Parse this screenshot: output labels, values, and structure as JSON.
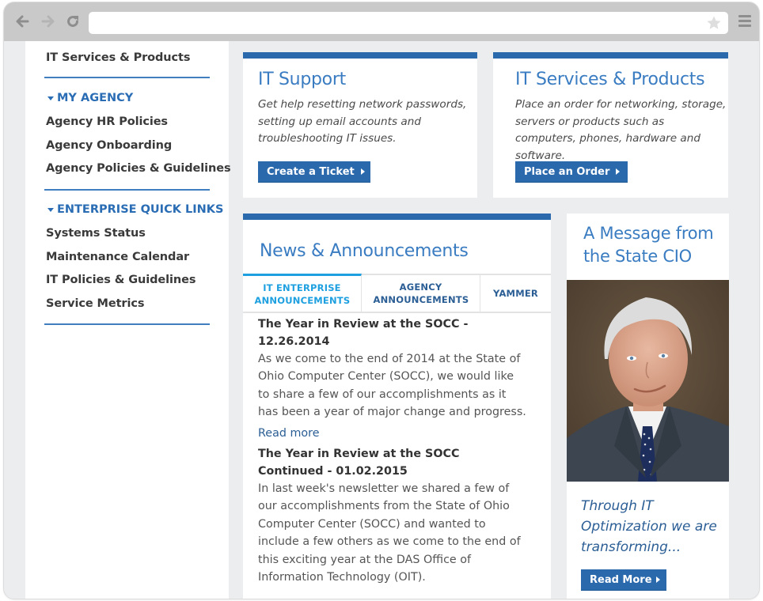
{
  "browser": {
    "icons": [
      "back-arrow-icon",
      "forward-arrow-icon",
      "reload-icon",
      "star-icon",
      "hamburger-menu-icon"
    ],
    "url": ""
  },
  "sidebar": {
    "top_link": "IT Services & Products",
    "sections": [
      {
        "heading": "MY AGENCY",
        "items": [
          "Agency HR Policies",
          "Agency Onboarding",
          "Agency Policies & Guidelines"
        ]
      },
      {
        "heading": "ENTERPRISE QUICK LINKS",
        "items": [
          "Systems Status",
          "Maintenance Calendar",
          "IT Policies & Guidelines",
          "Service Metrics"
        ]
      }
    ]
  },
  "cards": {
    "it_support": {
      "title": "IT Support",
      "description": "Get help resetting network passwords, setting up email accounts and troubleshooting IT issues.",
      "button": "Create a Ticket"
    },
    "it_services": {
      "title": "IT Services & Products",
      "description": "Place an order for networking, storage, servers or products such as computers, phones, hardware and software.",
      "button": "Place an Order"
    }
  },
  "news": {
    "title": "News & Announcements",
    "tabs": [
      {
        "label": "IT ENTERPRISE ANNOUNCEMENTS",
        "active": true
      },
      {
        "label": "AGENCY ANNOUNCEMENTS",
        "active": false
      },
      {
        "label": "YAMMER",
        "active": false
      }
    ],
    "articles": [
      {
        "title": "The Year in Review at the SOCC - 12.26.2014",
        "body": "As we come to the end of 2014 at the State of Ohio Computer Center (SOCC), we would like to share a few of our accomplishments as it has been a year of major change and progress.",
        "link": "Read more"
      },
      {
        "title": "The Year in Review at the SOCC Continued - 01.02.2015",
        "body": "In last week's newsletter we shared a few of our accomplishments from the State of Ohio Computer Center (SOCC) and wanted to include a few others as we come to the end of this exciting year at the DAS Office of Information Technology (OIT).",
        "link": ""
      }
    ]
  },
  "cio": {
    "title": "A Message from the State CIO",
    "photo_alt": "Portrait of the State CIO",
    "quote": "Through IT Optimization we are transforming...",
    "button": "Read More"
  },
  "colors": {
    "brand_blue": "#2b69ad",
    "heading_blue": "#3a7cc1",
    "active_tab": "#1ea0e0",
    "page_bg": "#ecedef"
  }
}
